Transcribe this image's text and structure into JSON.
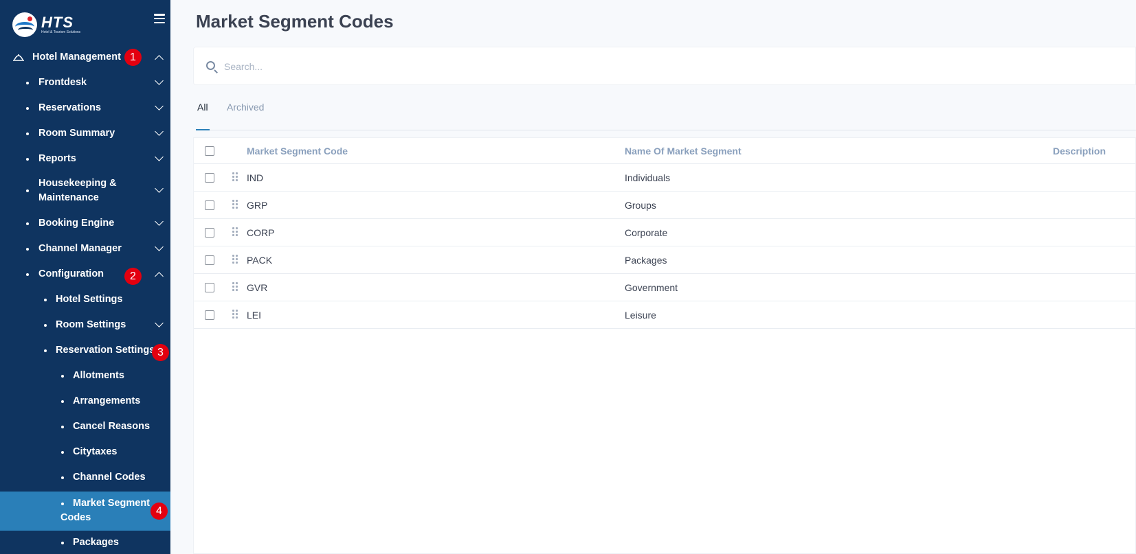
{
  "brand": {
    "name": "HTS",
    "tagline": "Hotel & Tourism Solutions"
  },
  "sidebar": {
    "items": [
      {
        "label": "Hotel Management",
        "badge": "1"
      },
      {
        "label": "Frontdesk"
      },
      {
        "label": "Reservations"
      },
      {
        "label": "Room Summary"
      },
      {
        "label": "Reports"
      },
      {
        "label": "Housekeeping & Maintenance"
      },
      {
        "label": "Booking Engine"
      },
      {
        "label": "Channel Manager"
      },
      {
        "label": "Configuration",
        "badge": "2"
      },
      {
        "label": "Hotel Settings"
      },
      {
        "label": "Room Settings"
      },
      {
        "label": "Reservation Settings",
        "badge": "3"
      },
      {
        "label": "Allotments"
      },
      {
        "label": "Arrangements"
      },
      {
        "label": "Cancel Reasons"
      },
      {
        "label": "Citytaxes"
      },
      {
        "label": "Channel Codes"
      },
      {
        "label": "Market Segment Codes",
        "badge": "4",
        "active": true
      },
      {
        "label": "Packages"
      }
    ]
  },
  "main": {
    "title": "Market Segment Codes",
    "search": {
      "placeholder": "Search..."
    },
    "tabs": [
      {
        "label": "All",
        "active": true
      },
      {
        "label": "Archived"
      }
    ],
    "table": {
      "columns": [
        "Market Segment Code",
        "Name Of Market Segment",
        "Description"
      ],
      "rows": [
        {
          "code": "IND",
          "name": "Individuals",
          "description": ""
        },
        {
          "code": "GRP",
          "name": "Groups",
          "description": ""
        },
        {
          "code": "CORP",
          "name": "Corporate",
          "description": ""
        },
        {
          "code": "PACK",
          "name": "Packages",
          "description": ""
        },
        {
          "code": "GVR",
          "name": "Government",
          "description": ""
        },
        {
          "code": "LEI",
          "name": "Leisure",
          "description": ""
        }
      ]
    }
  },
  "colors": {
    "sidebar_bg": "#0f3460",
    "active_item": "#2a7fb8",
    "badge": "#e3000f"
  }
}
